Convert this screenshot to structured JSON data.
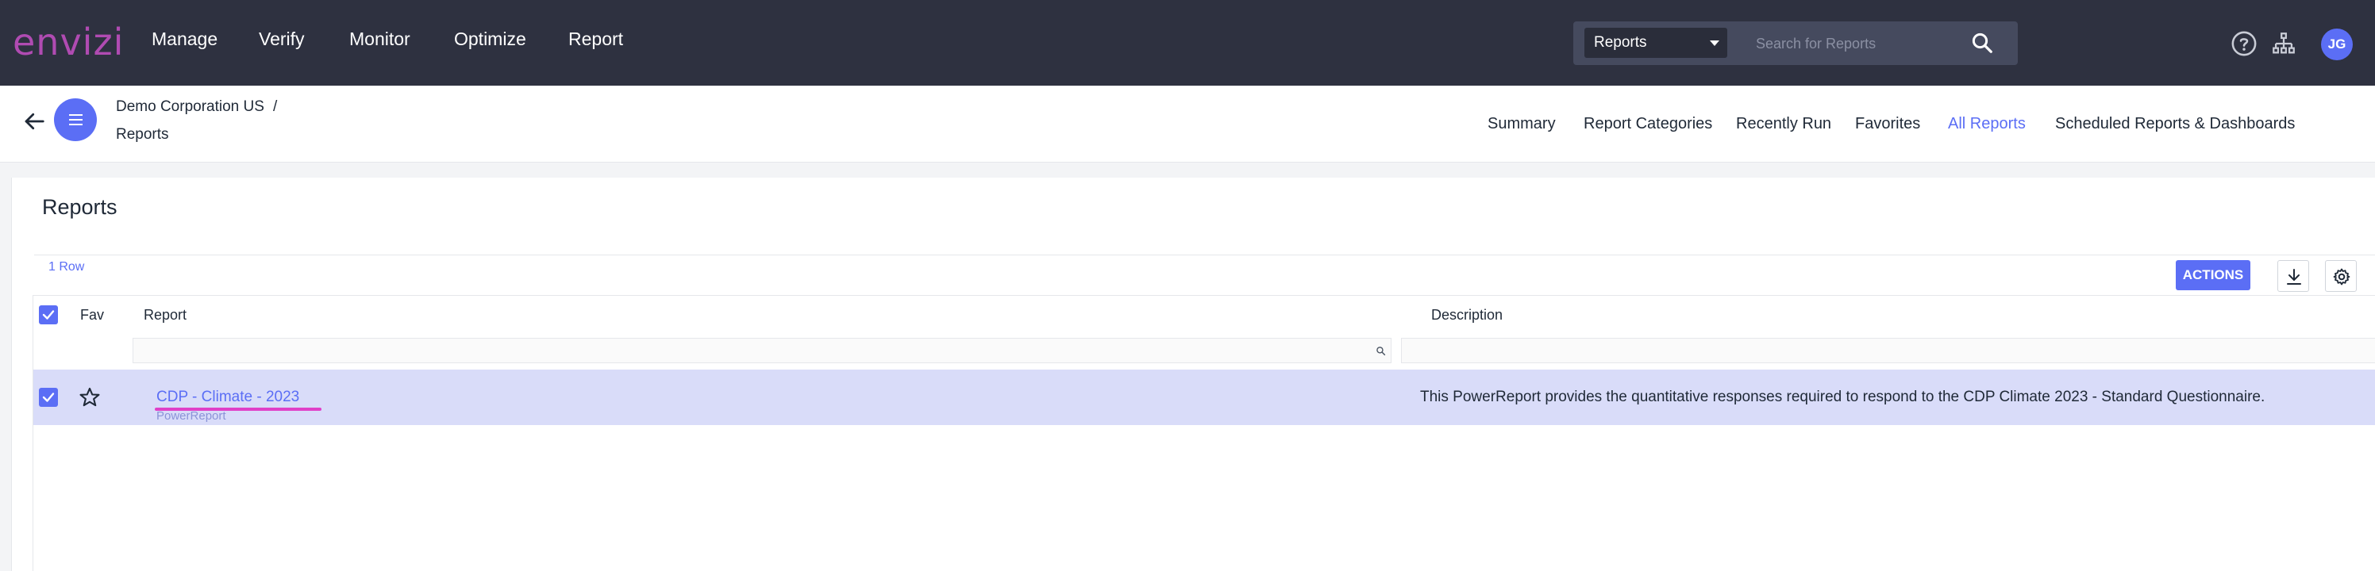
{
  "brand": {
    "logo": "envizi",
    "accent": "#5b6ef5",
    "logo_color": "#b04bb2"
  },
  "nav": {
    "items": [
      "Manage",
      "Verify",
      "Monitor",
      "Optimize",
      "Report"
    ]
  },
  "search": {
    "scope": "Reports",
    "placeholder": "Search for Reports",
    "icon": "search-icon"
  },
  "top_icons": [
    "help-icon",
    "hierarchy-icon"
  ],
  "user": {
    "initials": "JG"
  },
  "breadcrumb": {
    "org": "Demo Corporation US",
    "separator": "/",
    "page": "Reports"
  },
  "tabs": [
    {
      "label": "Summary",
      "active": false
    },
    {
      "label": "Report Categories",
      "active": false
    },
    {
      "label": "Recently Run",
      "active": false
    },
    {
      "label": "Favorites",
      "active": false
    },
    {
      "label": "All Reports",
      "active": true
    },
    {
      "label": "Scheduled Reports & Dashboards",
      "active": false
    }
  ],
  "page": {
    "title": "Reports",
    "row_count": "1 Row",
    "actions_label": "ACTIONS"
  },
  "table": {
    "columns": [
      "Fav",
      "Report",
      "Description"
    ],
    "rows": [
      {
        "selected": true,
        "favorite": false,
        "report": "CDP - Climate - 2023",
        "type": "PowerReport",
        "description": "This PowerReport provides the quantitative responses required to respond to the CDP Climate 2023 - Standard Questionnaire."
      }
    ]
  }
}
